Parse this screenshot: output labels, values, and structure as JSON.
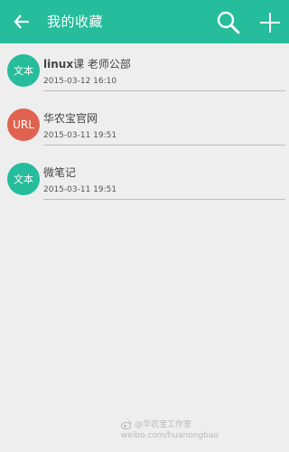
{
  "app_bar": {
    "title": "我的收藏",
    "background": "#25bd9b",
    "back_icon": "arrow-left-icon",
    "search_icon": "search-icon",
    "add_icon": "plus-icon"
  },
  "items": [
    {
      "badge": "文本",
      "badge_color": "#25bd9b",
      "title_bold": "linux",
      "title_rest": "课 老师公部",
      "time": "2015-03-12 16:10"
    },
    {
      "badge": "URL",
      "badge_color": "#e06350",
      "title_bold": "",
      "title_rest": "华农宝官网",
      "time": "2015-03-11 19:51"
    },
    {
      "badge": "文本",
      "badge_color": "#25bd9b",
      "title_bold": "",
      "title_rest": "微笔记",
      "time": "2015-03-11 19:51"
    }
  ],
  "watermark": {
    "line1": "@华农宝工作室",
    "line2": "weibo.com/huanongbao",
    "icon": "weibo-icon"
  }
}
